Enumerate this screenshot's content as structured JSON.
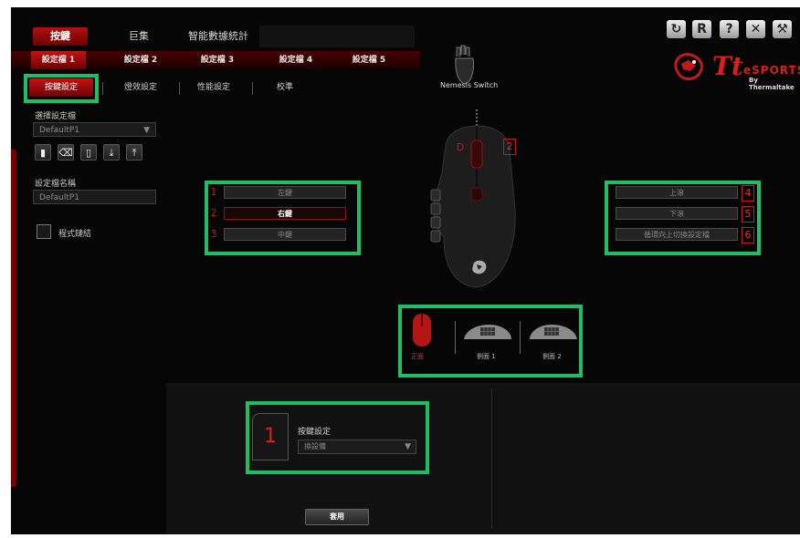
{
  "top_tabs": [
    {
      "label": "按鍵"
    },
    {
      "label": "巨集"
    },
    {
      "label": "智能數據統計"
    }
  ],
  "top_icons": [
    {
      "glyph": "↻",
      "icon": "refresh-icon"
    },
    {
      "glyph": "R",
      "icon": "reset-icon"
    },
    {
      "glyph": "?",
      "icon": "help-icon"
    },
    {
      "glyph": "✕",
      "icon": "close-icon"
    },
    {
      "glyph": "⚒",
      "icon": "tools-icon"
    }
  ],
  "profiles": [
    {
      "label": "設定檔 1"
    },
    {
      "label": "設定檔 2"
    },
    {
      "label": "設定檔 3"
    },
    {
      "label": "設定檔 4"
    },
    {
      "label": "設定檔 5"
    }
  ],
  "sub_tabs": [
    {
      "label": "按鍵設定"
    },
    {
      "label": "燈效設定"
    },
    {
      "label": "性能設定"
    },
    {
      "label": "校準"
    }
  ],
  "nemesis_label": "Nemesis Switch",
  "brand": {
    "logo_tt": "Tt",
    "logo_word": "eSPORTS",
    "logo_sub": "By Thermaltake",
    "accent": "#e01b1b",
    "highlight": "#1fbe63"
  },
  "sidebar": {
    "select_profile_label": "選擇設定檔",
    "select_profile_value": "DefaultP1",
    "file_buttons": [
      {
        "glyph": "▮",
        "icon": "save-icon"
      },
      {
        "glyph": "⌫",
        "icon": "delete-icon"
      },
      {
        "glyph": "▯",
        "icon": "copy-icon"
      },
      {
        "glyph": "⤓",
        "icon": "import-icon"
      },
      {
        "glyph": "⤒",
        "icon": "export-icon"
      }
    ],
    "profile_name_label": "設定檔名稱",
    "profile_name_value": "DefaultP1",
    "program_link_label": "程式鏈結"
  },
  "left_buttons": [
    {
      "num": "1",
      "label": "左鍵"
    },
    {
      "num": "2",
      "label": "右鍵"
    },
    {
      "num": "3",
      "label": "中鍵"
    }
  ],
  "right_buttons": [
    {
      "num": "4",
      "label": "上滾"
    },
    {
      "num": "5",
      "label": "下滾"
    },
    {
      "num": "6",
      "label": "循環向上切換設定檔"
    }
  ],
  "mouse_labels": {
    "d": "D",
    "b2": "2"
  },
  "views": [
    {
      "label": "正面"
    },
    {
      "label": "側面 1"
    },
    {
      "label": "側面 2"
    }
  ],
  "key_setting": {
    "num": "1",
    "title": "按鍵設定",
    "value": "換設備"
  },
  "apply_label": "套用"
}
